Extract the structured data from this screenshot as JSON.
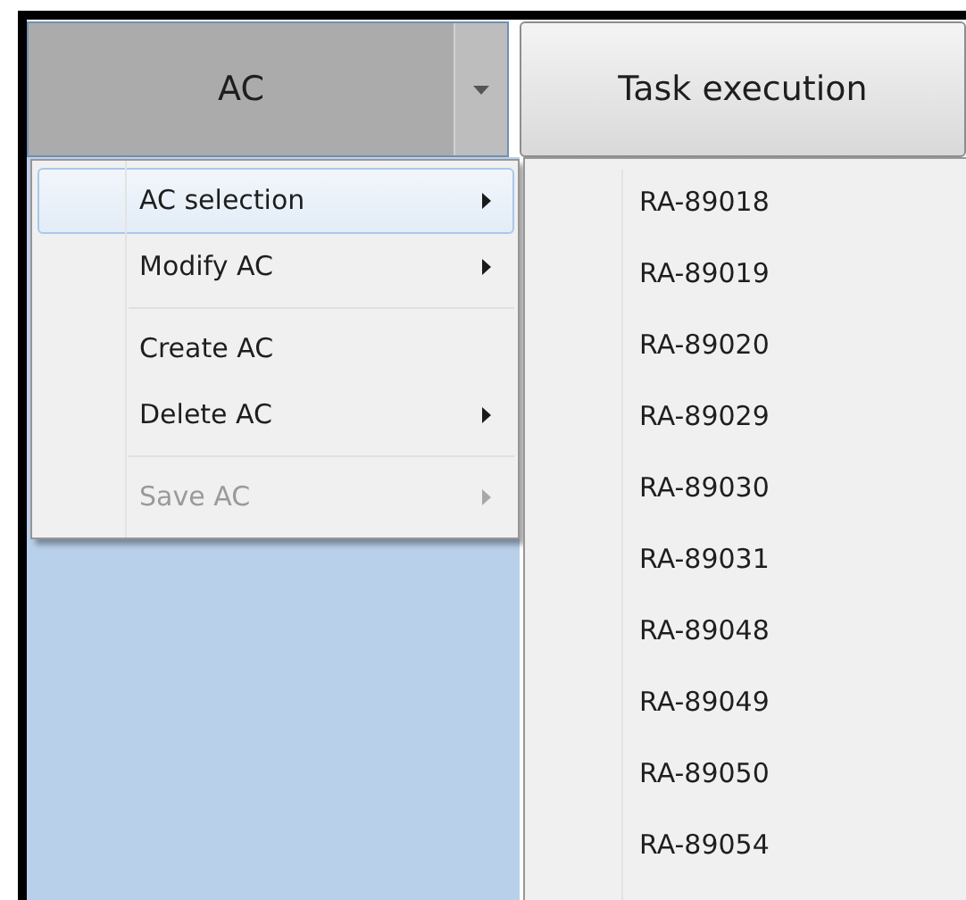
{
  "toolbar": {
    "ac_button": {
      "label": "AC",
      "pressed": true
    },
    "task_button": {
      "label": "Task execution"
    }
  },
  "menu": [
    {
      "kind": "item",
      "label": "AC selection",
      "submenu": true,
      "disabled": false,
      "selected": true
    },
    {
      "kind": "item",
      "label": "Modify AC",
      "submenu": true,
      "disabled": false,
      "selected": false
    },
    {
      "kind": "separator"
    },
    {
      "kind": "item",
      "label": "Create AC",
      "submenu": false,
      "disabled": false,
      "selected": false
    },
    {
      "kind": "item",
      "label": "Delete AC",
      "submenu": true,
      "disabled": false,
      "selected": false
    },
    {
      "kind": "separator"
    },
    {
      "kind": "item",
      "label": "Save AC",
      "submenu": true,
      "disabled": true,
      "selected": false
    }
  ],
  "submenu": [
    "RA-89018",
    "RA-89019",
    "RA-89020",
    "RA-89029",
    "RA-89030",
    "RA-89031",
    "RA-89048",
    "RA-89049",
    "RA-89050",
    "RA-89054"
  ]
}
